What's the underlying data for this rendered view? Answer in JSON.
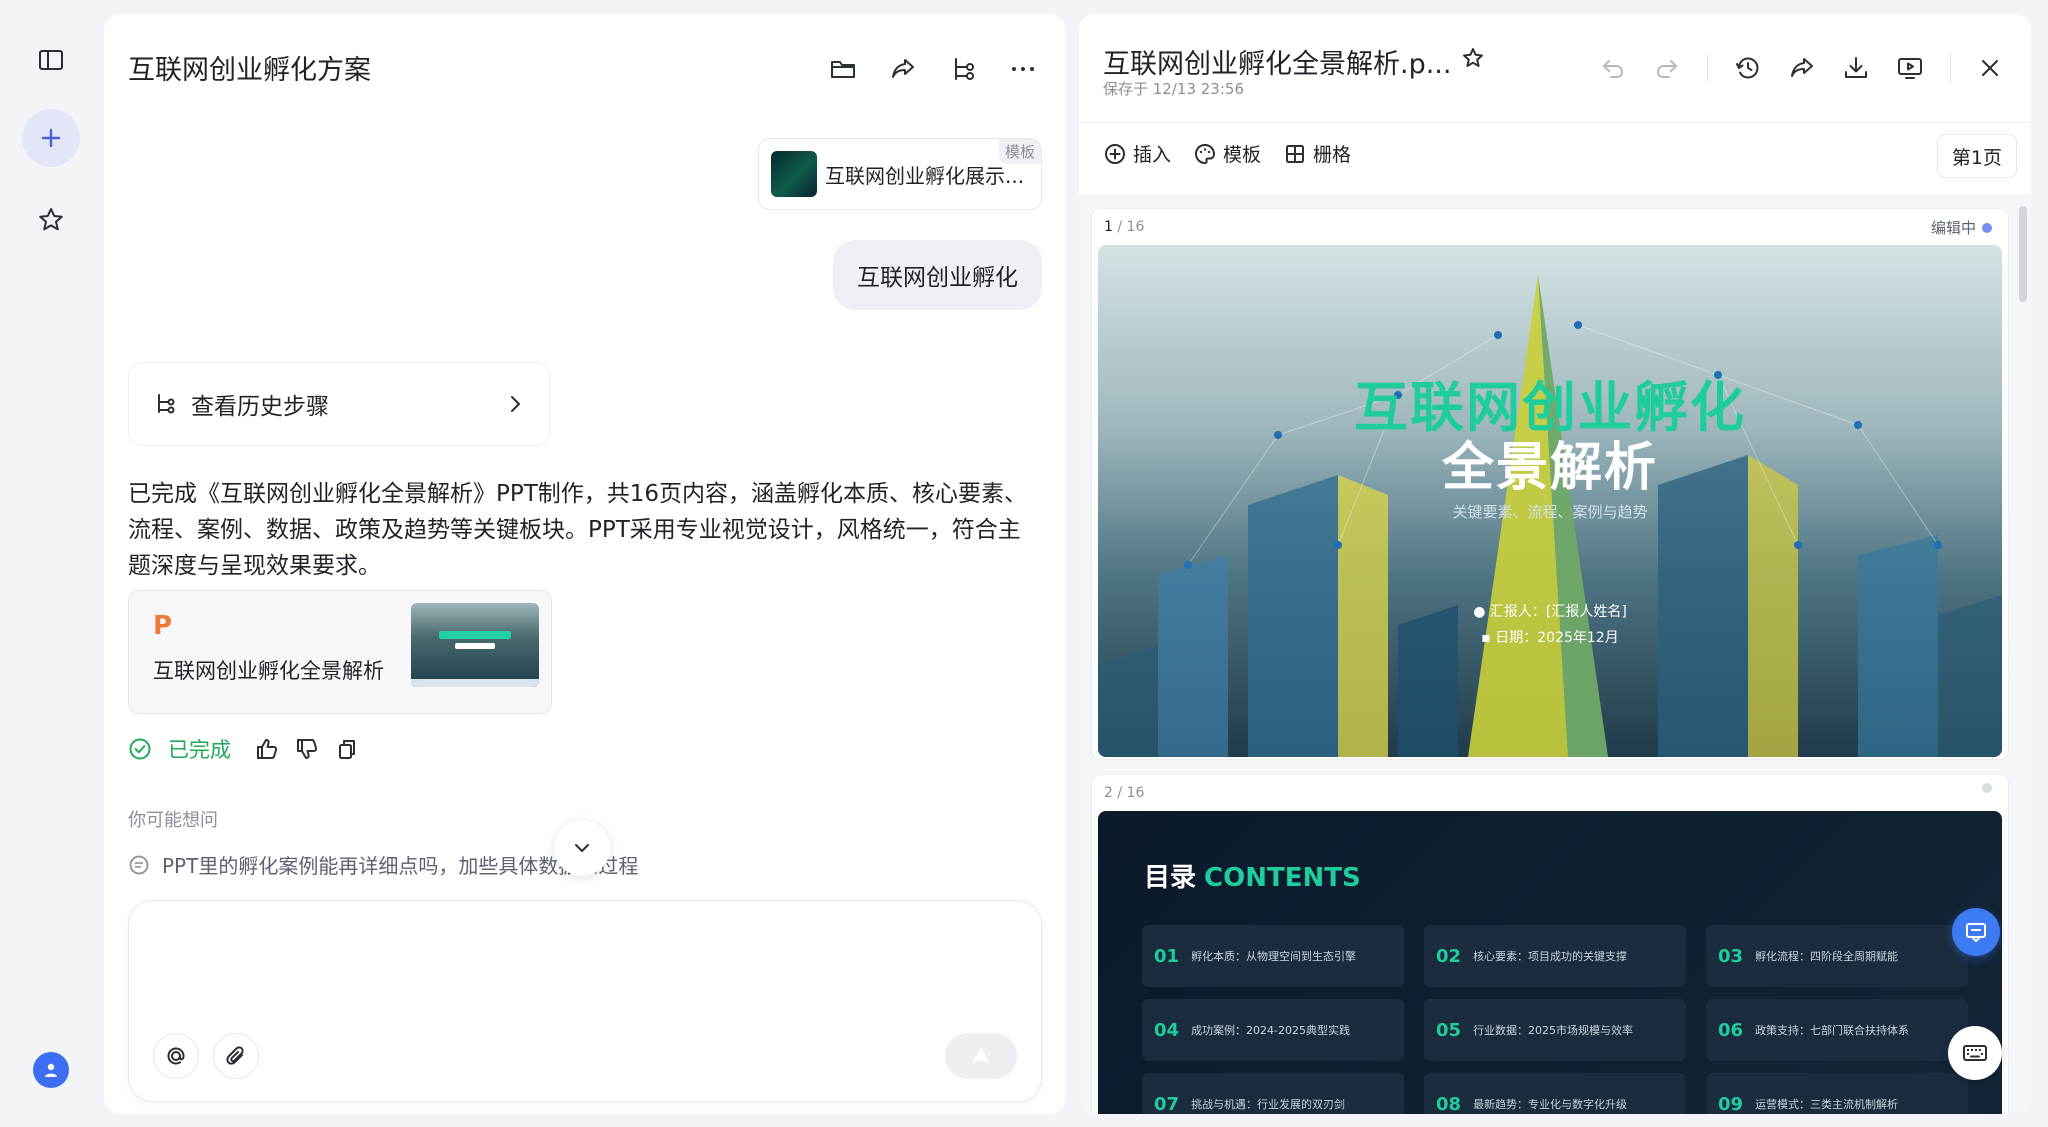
{
  "chat": {
    "title": "互联网创业孵化方案",
    "template_card": {
      "name": "互联网创业孵化展示...",
      "tag": "模板"
    },
    "user_message": "互联网创业孵化",
    "history_button": "查看历史步骤",
    "reply": "已完成《互联网创业孵化全景解析》PPT制作，共16页内容，涵盖孵化本质、核心要素、流程、案例、数据、政策及趋势等关键板块。PPT采用专业视觉设计，风格统一，符合主题深度与呈现效果要求。",
    "ppt_card": {
      "badge": "P",
      "name": "互联网创业孵化全景解析"
    },
    "status": "已完成",
    "maybe_title": "你可能想问",
    "suggestion": "PPT里的孵化案例能再详细点吗，加些具体数据和过程",
    "composer": {
      "placeholder": ""
    }
  },
  "preview": {
    "title": "互联网创业孵化全景解析.p...",
    "saved": "保存于 12/13 23:56",
    "actions": {
      "insert": "插入",
      "template": "模板",
      "grid": "栅格"
    },
    "page_indicator": "第1页",
    "slide1": {
      "number": "1",
      "total": "/ 16",
      "editing": "编辑中",
      "title_line1": "互联网创业孵化",
      "title_line2": "全景解析",
      "subtitle": "关键要素、流程、案例与趋势",
      "reporter": "汇报人：[汇报人姓名]",
      "date": "日期：2025年12月"
    },
    "slide2": {
      "number": "2",
      "total": "/ 16",
      "title": "目录",
      "title_en": "CONTENTS",
      "items": [
        {
          "num": "01",
          "text": "孵化本质：从物理空间到生态引擎"
        },
        {
          "num": "02",
          "text": "核心要素：项目成功的关键支撑"
        },
        {
          "num": "03",
          "text": "孵化流程：四阶段全周期赋能"
        },
        {
          "num": "04",
          "text": "成功案例：2024-2025典型实践"
        },
        {
          "num": "05",
          "text": "行业数据：2025市场规模与效率"
        },
        {
          "num": "06",
          "text": "政策支持：七部门联合扶持体系"
        },
        {
          "num": "07",
          "text": "挑战与机遇：行业发展的双刃剑"
        },
        {
          "num": "08",
          "text": "最新趋势：专业化与数字化升级"
        },
        {
          "num": "09",
          "text": "运营模式：三类主流机制解析"
        }
      ]
    }
  },
  "colors": {
    "accent": "#1fcc9b",
    "brand_blue": "#3d7bf2",
    "success": "#22a85a",
    "ppt_orange": "#f0793a"
  }
}
